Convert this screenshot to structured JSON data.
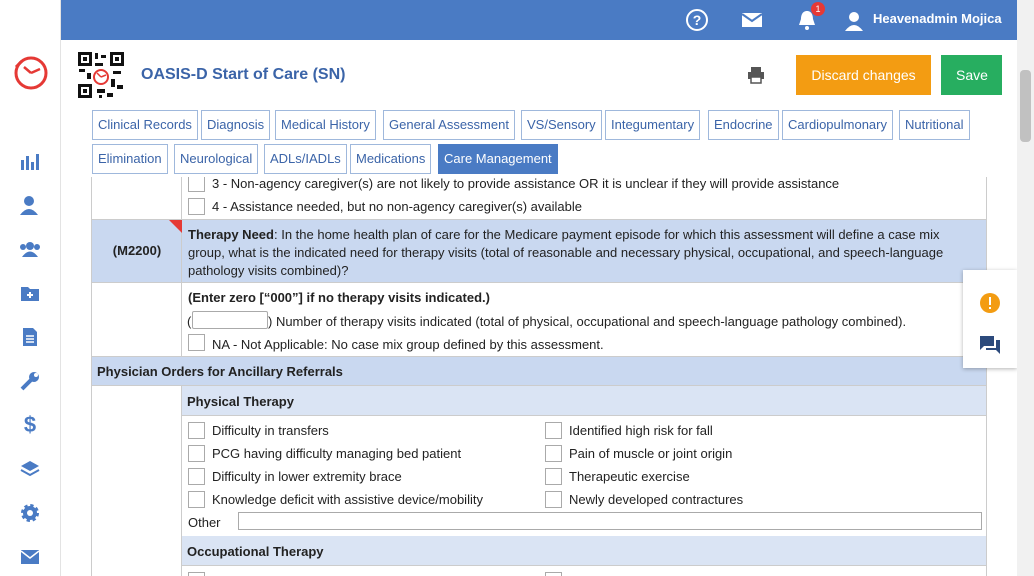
{
  "user": {
    "name": "Heavenadmin Mojica",
    "notifications": "1"
  },
  "page": {
    "title": "OASIS-D Start of Care (SN)",
    "discard_label": "Discard changes",
    "save_label": "Save"
  },
  "tabs": [
    "Clinical Records",
    "Diagnosis",
    "Medical History",
    "General Assessment",
    "VS/Sensory",
    "Integumentary",
    "Endocrine",
    "Cardiopulmonary",
    "Nutritional",
    "Elimination",
    "Neurological",
    "ADLs/IADLs",
    "Medications",
    "Care Management"
  ],
  "active_tab": "Care Management",
  "caregiver_opts": [
    "3 - Non-agency caregiver(s) are not likely to provide assistance OR it is unclear if they will provide assistance",
    "4 - Assistance needed, but no non-agency caregiver(s) available"
  ],
  "m2200": {
    "code": "(M2200)",
    "bold": "Therapy Need",
    "text": ": In the home health plan of care for the Medicare payment episode for which this assessment will define a case mix",
    "text2": "group, what is the indicated need for therapy visits (total of reasonable and necessary physical, occupational, and speech-language",
    "text3": "pathology visits combined)?",
    "instruction": "(Enter zero [“000”] if no therapy visits indicated.)",
    "paren_open": "(",
    "visits_label": ") Number of therapy visits indicated (total of physical, occupational and speech-language pathology combined).",
    "na_label": "NA - Not Applicable: No case mix group defined by this assessment."
  },
  "ancillary": {
    "heading": "Physician Orders for Ancillary Referrals",
    "pt_heading": "Physical Therapy",
    "pt_left": [
      "Difficulty in transfers",
      "PCG having difficulty managing bed patient",
      "Difficulty in lower extremity brace",
      "Knowledge deficit with assistive device/mobility"
    ],
    "pt_right": [
      "Identified high risk for fall",
      "Pain of muscle or joint origin",
      "Therapeutic exercise",
      "Newly developed contractures"
    ],
    "other_label": "Other",
    "ot_heading": "Occupational Therapy"
  }
}
